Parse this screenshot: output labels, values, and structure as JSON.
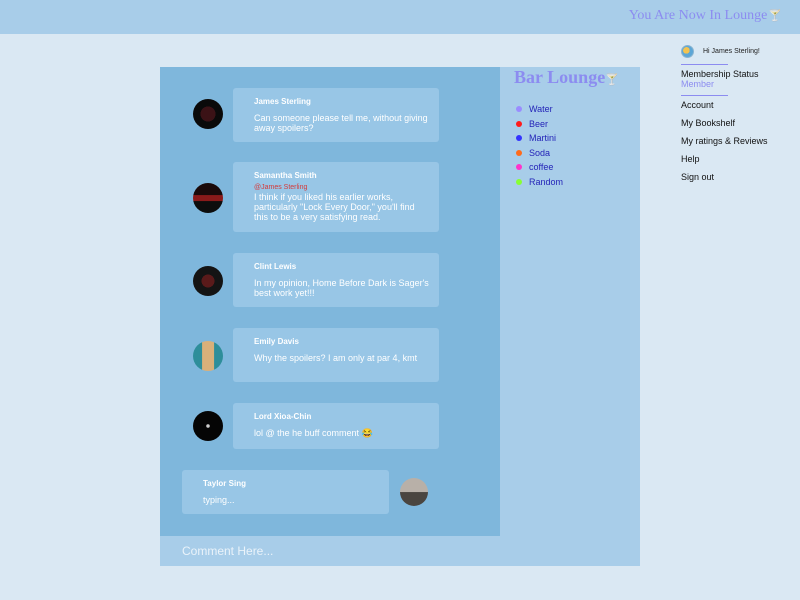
{
  "header": {
    "title": "You Are Now In Lounge",
    "title_icon": "cocktail-glass-icon",
    "title_glyph": "🍸"
  },
  "lounge": {
    "title": "Bar Lounge",
    "title_glyph": "🍸",
    "drinks": [
      {
        "label": "Water",
        "color": "#9a8cff"
      },
      {
        "label": "Beer",
        "color": "#ff1a1a"
      },
      {
        "label": "Martini",
        "color": "#3333ff"
      },
      {
        "label": "Soda",
        "color": "#ff6a1a"
      },
      {
        "label": "coffee",
        "color": "#ff33cc"
      },
      {
        "label": "Random",
        "color": "#88ff33"
      }
    ]
  },
  "messages": [
    {
      "author": "James Sterling",
      "text": "Can someone please tell me, without giving away spoilers?",
      "avatar": "book-cover-avatar"
    },
    {
      "author": "Samantha Smith",
      "mention": "@James Sterling",
      "text": "I think if you liked his earlier works, particularly \"Lock Every Door,\" you'll find this to be a very satisfying read.",
      "avatar": "her-poster-avatar"
    },
    {
      "author": "Clint Lewis",
      "text": "In my opinion, Home Before Dark is Sager's best work yet!!!",
      "avatar": "dark-book-avatar"
    },
    {
      "author": "Emily Davis",
      "text": "Why the spoilers? I am only at par 4, kmt",
      "avatar": "woman-portrait-avatar"
    },
    {
      "author": "Lord Xioa-Chin",
      "text": "lol @ the he buff comment 😂",
      "avatar": "night-figure-avatar"
    }
  ],
  "typing": {
    "author": "Taylor Sing",
    "text": "typing...",
    "avatar": "group-photo-avatar"
  },
  "comment": {
    "placeholder": "Comment Here..."
  },
  "sidebar": {
    "greeting": "Hi James Sterling!",
    "membership_label": "Membership Status",
    "membership_value": "Member",
    "links": [
      "Account",
      "My Bookshelf",
      "My ratings & Reviews",
      "Help",
      "Sign out"
    ]
  }
}
